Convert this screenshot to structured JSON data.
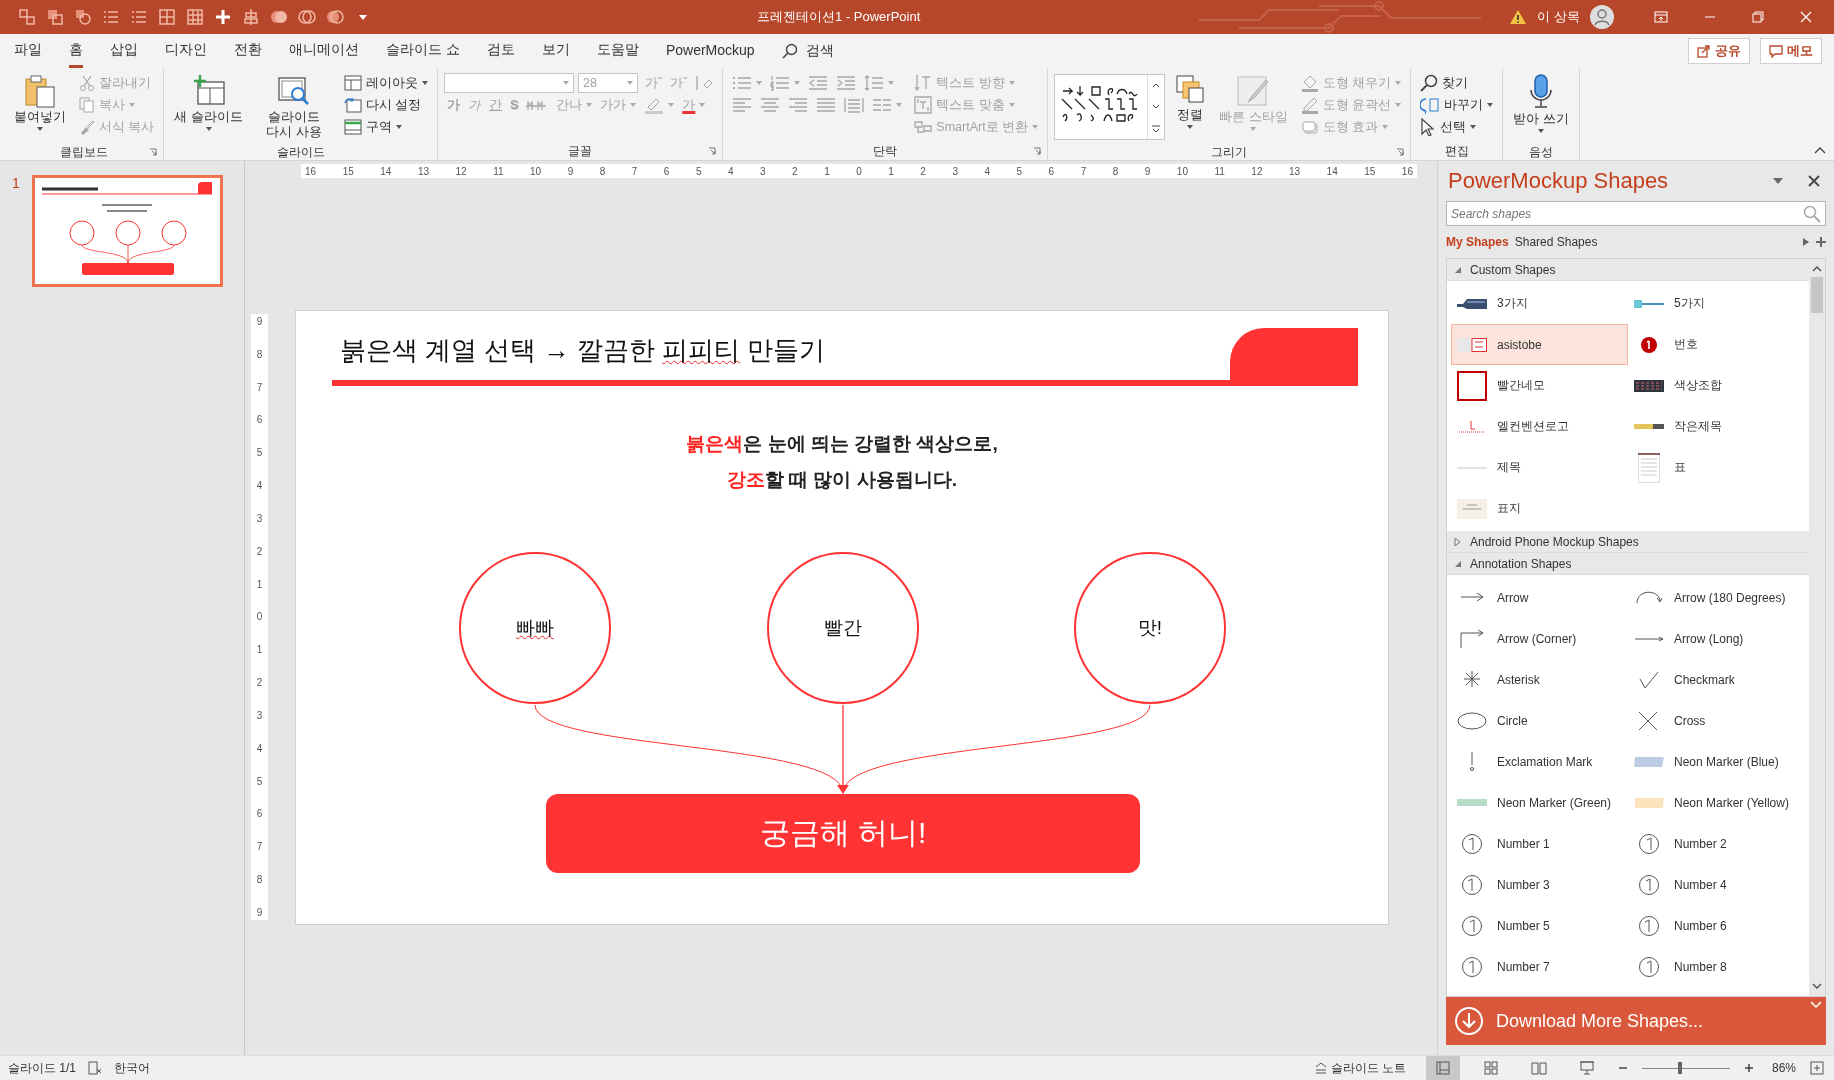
{
  "title_bar": {
    "title": "프레젠테이션1  -  PowerPoint",
    "user": "이 상목"
  },
  "menu_tabs": [
    {
      "label": "파일",
      "selected": false
    },
    {
      "label": "홈",
      "selected": true
    },
    {
      "label": "삽입",
      "selected": false
    },
    {
      "label": "디자인",
      "selected": false
    },
    {
      "label": "전환",
      "selected": false
    },
    {
      "label": "애니메이션",
      "selected": false
    },
    {
      "label": "슬라이드 쇼",
      "selected": false
    },
    {
      "label": "검토",
      "selected": false
    },
    {
      "label": "보기",
      "selected": false
    },
    {
      "label": "도움말",
      "selected": false
    },
    {
      "label": "PowerMockup",
      "selected": false
    }
  ],
  "search": {
    "label": "검색"
  },
  "share_button": "공유",
  "memo_button": "메모",
  "ribbon": [
    {
      "label": "클립보드",
      "launcher": true,
      "blocks": [
        [
          [
            {
              "kind": "paste",
              "label": "붙여넣기",
              "dropdown": true,
              "disabled": false
            }
          ]
        ],
        [
          [
            {
              "kind": "cut",
              "label": "잘라내기",
              "disabled": true
            }
          ],
          [
            {
              "kind": "copy",
              "label": "복사",
              "dropdown": true,
              "disabled": true
            }
          ],
          [
            {
              "kind": "brush",
              "label": "서식 복사",
              "disabled": true
            }
          ]
        ]
      ]
    },
    {
      "label": "슬라이드",
      "launcher": false,
      "blocks": [
        [
          [
            {
              "kind": "newslide",
              "label": "새 슬라이드",
              "dropdown": true,
              "disabled": false
            }
          ]
        ],
        [
          [
            {
              "kind": "reuse",
              "label": "슬라이드 다시 사용",
              "disabled": false
            }
          ]
        ],
        [
          [
            {
              "kind": "layout",
              "label": "레이아웃",
              "dropdown": true,
              "disabled": false
            }
          ],
          [
            {
              "kind": "reset",
              "label": "다시 설정",
              "disabled": false
            }
          ],
          [
            {
              "kind": "section",
              "label": "구역",
              "dropdown": true,
              "disabled": false
            }
          ]
        ]
      ]
    },
    {
      "label": "글꼴",
      "launcher": true,
      "blocks": [
        [
          [
            {
              "kind": "fontbox",
              "disabled": true
            },
            {
              "kind": "sizebox",
              "value": "28",
              "disabled": true
            },
            {
              "kind": "glyph",
              "label": "가ˆ",
              "disabled": true
            },
            {
              "kind": "glyph",
              "label": "가ˇ",
              "disabled": true
            },
            {
              "kind": "clear",
              "disabled": true
            }
          ],
          [
            {
              "kind": "bold",
              "label": "가",
              "disabled": true
            },
            {
              "kind": "italic",
              "label": "가",
              "disabled": true
            },
            {
              "kind": "underline",
              "label": "간",
              "disabled": true
            },
            {
              "kind": "shadow",
              "label": "S",
              "disabled": true
            },
            {
              "kind": "strike",
              "disabled": true
            },
            {
              "kind": "spacing",
              "label": "간나",
              "dropdown": true,
              "disabled": true
            },
            {
              "kind": "case",
              "label": "가가",
              "dropdown": true,
              "disabled": true
            },
            {
              "kind": "highlight",
              "dropdown": true,
              "disabled": true
            },
            {
              "kind": "color",
              "label": "가",
              "dropdown": true,
              "disabled": true
            }
          ]
        ]
      ]
    },
    {
      "label": "단락",
      "launcher": true,
      "blocks": [
        [
          [
            {
              "kind": "bullets",
              "dropdown": true,
              "disabled": true
            },
            {
              "kind": "numbering",
              "dropdown": true,
              "disabled": true
            },
            {
              "kind": "outdent",
              "disabled": true
            },
            {
              "kind": "indent",
              "disabled": true
            },
            {
              "kind": "linespacing",
              "dropdown": true,
              "disabled": true
            }
          ],
          [
            {
              "kind": "left",
              "disabled": true
            },
            {
              "kind": "center",
              "disabled": true
            },
            {
              "kind": "right",
              "disabled": true
            },
            {
              "kind": "justify",
              "disabled": true
            },
            {
              "kind": "distribute",
              "disabled": true
            },
            {
              "kind": "columns",
              "dropdown": true,
              "disabled": true
            }
          ]
        ],
        [
          [
            {
              "kind": "textdir",
              "label": "텍스트 방향",
              "dropdown": true,
              "disabled": true
            }
          ],
          [
            {
              "kind": "textalign",
              "label": "텍스트 맞춤",
              "dropdown": true,
              "disabled": true
            }
          ],
          [
            {
              "kind": "smartart",
              "label": "SmartArt로 변환",
              "dropdown": true,
              "disabled": true
            }
          ]
        ]
      ]
    },
    {
      "label": "그리기",
      "launcher": true,
      "blocks": [
        [
          [
            {
              "kind": "gallery",
              "disabled": false
            }
          ]
        ],
        [
          [
            {
              "kind": "arrange",
              "label": "정렬",
              "dropdown": true,
              "disabled": false
            }
          ]
        ],
        [
          [
            {
              "kind": "quickstyle",
              "label": "빠른 스타일",
              "dropdown": true,
              "disabled": true
            }
          ]
        ],
        [
          [
            {
              "kind": "fill",
              "label": "도형 채우기",
              "dropdown": true,
              "disabled": true
            }
          ],
          [
            {
              "kind": "outline",
              "label": "도형 윤곽선",
              "dropdown": true,
              "disabled": true
            }
          ],
          [
            {
              "kind": "effect",
              "label": "도형 효과",
              "dropdown": true,
              "disabled": true
            }
          ]
        ]
      ]
    },
    {
      "label": "편집",
      "launcher": false,
      "blocks": [
        [
          [
            {
              "kind": "find",
              "label": "찾기",
              "disabled": false
            }
          ],
          [
            {
              "kind": "replace",
              "label": "바꾸기",
              "dropdown": true,
              "disabled": false
            }
          ],
          [
            {
              "kind": "select",
              "label": "선택",
              "dropdown": true,
              "disabled": false
            }
          ]
        ]
      ]
    },
    {
      "label": "음성",
      "launcher": false,
      "blocks": [
        [
          [
            {
              "kind": "dictate",
              "label": "받아 쓰기",
              "dropdown": true,
              "disabled": false
            }
          ]
        ]
      ]
    }
  ],
  "thumbnails": [
    {
      "number": "1",
      "selected": true
    }
  ],
  "rulers": {
    "horizontal": [
      "16",
      "15",
      "14",
      "13",
      "12",
      "11",
      "10",
      "9",
      "8",
      "7",
      "6",
      "5",
      "4",
      "3",
      "2",
      "1",
      "0",
      "1",
      "2",
      "3",
      "4",
      "5",
      "6",
      "7",
      "8",
      "9",
      "10",
      "11",
      "12",
      "13",
      "14",
      "15",
      "16"
    ],
    "vertical": [
      "9",
      "8",
      "7",
      "6",
      "5",
      "4",
      "3",
      "2",
      "1",
      "0",
      "1",
      "2",
      "3",
      "4",
      "5",
      "6",
      "7",
      "8",
      "9"
    ]
  },
  "slide": {
    "title": [
      {
        "text": "붉은색 계열 선택 → 깔끔한 ",
        "misspelled": false
      },
      {
        "text": "피피티",
        "misspelled": true
      },
      {
        "text": " 만들기",
        "misspelled": false
      }
    ],
    "lines": [
      [
        {
          "text": "붉은색",
          "accent": true
        },
        {
          "text": "은 눈에 띄는 강렬한 색상으로,",
          "accent": false
        }
      ],
      [
        {
          "text": "강조",
          "accent": true
        },
        {
          "text": "할 때 많이 사용됩니다.",
          "accent": false
        }
      ]
    ],
    "circles": [
      {
        "label": "빠빠",
        "misspelled": true
      },
      {
        "label": "빨간",
        "misspelled": false
      },
      {
        "label": "맛!",
        "misspelled": false
      }
    ],
    "button": "궁금해 허니!"
  },
  "panel": {
    "title": "PowerMockup Shapes",
    "search_placeholder": "Search shapes",
    "tabs": [
      {
        "label": "My Shapes",
        "selected": true
      },
      {
        "label": "Shared Shapes",
        "selected": false
      }
    ],
    "sections": [
      {
        "title": "Custom Shapes",
        "expanded": true,
        "items": [
          {
            "label": "3가지",
            "selected": false
          },
          {
            "label": "5가지",
            "selected": false
          },
          {
            "label": "asistobe",
            "selected": true
          },
          {
            "label": "번호",
            "selected": false
          },
          {
            "label": "빨간네모",
            "selected": false
          },
          {
            "label": "색상조합",
            "selected": false
          },
          {
            "label": "엘컨벤션로고",
            "selected": false
          },
          {
            "label": "작은제목",
            "selected": false
          },
          {
            "label": "제목",
            "selected": false
          },
          {
            "label": "표",
            "selected": false
          },
          {
            "label": "표지",
            "selected": false
          }
        ]
      },
      {
        "title": "Android Phone Mockup Shapes",
        "expanded": false
      },
      {
        "title": "Annotation Shapes",
        "expanded": true,
        "items": [
          {
            "label": "Arrow",
            "selected": false
          },
          {
            "label": "Arrow (180 Degrees)",
            "selected": false
          },
          {
            "label": "Arrow (Corner)",
            "selected": false
          },
          {
            "label": "Arrow (Long)",
            "selected": false
          },
          {
            "label": "Asterisk",
            "selected": false
          },
          {
            "label": "Checkmark",
            "selected": false
          },
          {
            "label": "Circle",
            "selected": false
          },
          {
            "label": "Cross",
            "selected": false
          },
          {
            "label": "Exclamation Mark",
            "selected": false
          },
          {
            "label": "Neon Marker (Blue)",
            "selected": false
          },
          {
            "label": "Neon Marker (Green)",
            "selected": false
          },
          {
            "label": "Neon Marker (Yellow)",
            "selected": false
          },
          {
            "label": "Number 1",
            "selected": false
          },
          {
            "label": "Number 2",
            "selected": false
          },
          {
            "label": "Number 3",
            "selected": false
          },
          {
            "label": "Number 4",
            "selected": false
          },
          {
            "label": "Number 5",
            "selected": false
          },
          {
            "label": "Number 6",
            "selected": false
          },
          {
            "label": "Number 7",
            "selected": false
          },
          {
            "label": "Number 8",
            "selected": false
          }
        ]
      }
    ],
    "download_button": "Download More Shapes..."
  },
  "status_bar": {
    "slide_count": "슬라이드 1/1",
    "language": "한국어",
    "notes_button": "슬라이드 노트",
    "views": [
      {
        "kind": "normal",
        "selected": true
      },
      {
        "kind": "sorter",
        "selected": false
      },
      {
        "kind": "reading",
        "selected": false
      },
      {
        "kind": "show",
        "selected": false
      }
    ],
    "zoom": {
      "level": 0.43,
      "reading": "86%"
    }
  }
}
